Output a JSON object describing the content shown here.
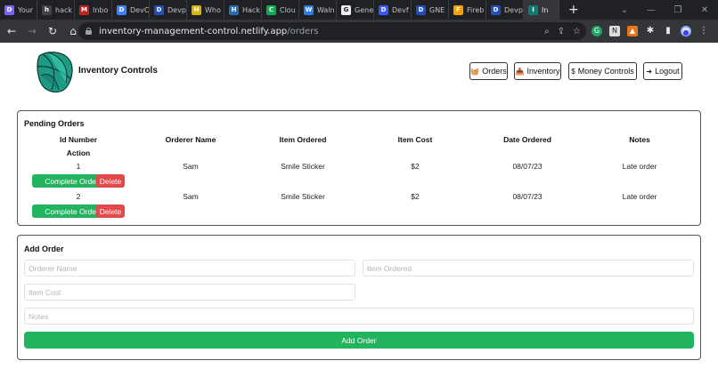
{
  "browser": {
    "tabs": [
      {
        "label": "Your",
        "fav": "D",
        "color": "#7b61ff"
      },
      {
        "label": "hack",
        "fav": "h",
        "color": "#444"
      },
      {
        "label": "Inbo",
        "fav": "M",
        "color": "#c5221f"
      },
      {
        "label": "DevC",
        "fav": "D",
        "color": "#3b82f6"
      },
      {
        "label": "Devp",
        "fav": "D",
        "color": "#1f4fbf"
      },
      {
        "label": "Who",
        "fav": "H",
        "color": "#d9b400"
      },
      {
        "label": "Hack",
        "fav": "H",
        "color": "#2b6cb0"
      },
      {
        "label": "Clou",
        "fav": "C",
        "color": "#13aa52"
      },
      {
        "label": "Waln",
        "fav": "W",
        "color": "#2f7be6"
      },
      {
        "label": "Gene",
        "fav": "G",
        "color": "#eee"
      },
      {
        "label": "Devf",
        "fav": "D",
        "color": "#3957ff"
      },
      {
        "label": "GNE",
        "fav": "D",
        "color": "#1f4fbf"
      },
      {
        "label": "Fireb",
        "fav": "F",
        "color": "#ffa000"
      },
      {
        "label": "Devp",
        "fav": "D",
        "color": "#1f4fbf"
      },
      {
        "label": "In",
        "fav": "I",
        "color": "#0f7c75",
        "active": true
      }
    ],
    "url_host": "inventory-management-control.netlify.app",
    "url_path": "/orders"
  },
  "header": {
    "brand": "Inventory Controls",
    "nav": {
      "orders": "Orders",
      "inventory": "Inventory",
      "money": "Money Controls",
      "logout": "Logout"
    }
  },
  "pending": {
    "title": "Pending Orders",
    "columns": {
      "id": "Id Number",
      "orderer": "Orderer Name",
      "item": "Item Ordered",
      "cost": "Item Cost",
      "date": "Date Ordered",
      "notes": "Notes",
      "action": "Action"
    },
    "rows": [
      {
        "id": "1",
        "orderer": "Sam",
        "item": "Smile Sticker",
        "cost": "$2",
        "date": "08/07/23",
        "notes": "Late order",
        "complete": "Complete Order",
        "delete": "Delete"
      },
      {
        "id": "2",
        "orderer": "Sam",
        "item": "Smile Sticker",
        "cost": "$2",
        "date": "08/07/23",
        "notes": "Late order",
        "complete": "Complete Order",
        "delete": "Delete"
      }
    ]
  },
  "add": {
    "title": "Add Order",
    "orderer_placeholder": "Orderer Name",
    "item_placeholder": "Item Ordered",
    "cost_placeholder": "Item Cost",
    "notes_placeholder": "Notes",
    "submit": "Add Order"
  },
  "colors": {
    "accent_green": "#22b35e",
    "danger_red": "#e54848"
  }
}
